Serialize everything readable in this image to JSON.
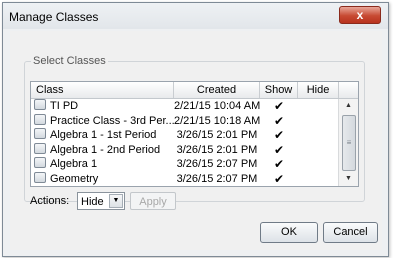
{
  "window": {
    "title": "Manage Classes",
    "close_glyph": "x"
  },
  "group": {
    "legend": "Select Classes"
  },
  "table": {
    "headers": {
      "class": "Class",
      "created": "Created",
      "show": "Show",
      "hide": "Hide"
    },
    "rows": [
      {
        "class": "TI PD",
        "created": "2/21/15 10:04 AM",
        "show": "✔",
        "hide": ""
      },
      {
        "class": "Practice Class - 3rd Per...",
        "created": "2/21/15 10:18 AM",
        "show": "✔",
        "hide": ""
      },
      {
        "class": "Algebra 1 - 1st Period",
        "created": "3/26/15 2:01 PM",
        "show": "✔",
        "hide": ""
      },
      {
        "class": "Algebra 1 - 2nd Period",
        "created": "3/26/15 2:01 PM",
        "show": "✔",
        "hide": ""
      },
      {
        "class": "Algebra 1",
        "created": "3/26/15 2:07 PM",
        "show": "✔",
        "hide": ""
      },
      {
        "class": "Geometry",
        "created": "3/26/15 2:07 PM",
        "show": "✔",
        "hide": ""
      }
    ]
  },
  "actions": {
    "label": "Actions:",
    "selected": "Hide",
    "apply_label": "Apply"
  },
  "buttons": {
    "ok": "OK",
    "cancel": "Cancel"
  },
  "icons": {
    "checkbox": "checkbox-icon",
    "checkmark": "checkmark-icon",
    "dropdown": "chevron-down-icon"
  },
  "colors": {
    "close_button": "#c74a33",
    "window_bg": "#f0f0f0"
  }
}
